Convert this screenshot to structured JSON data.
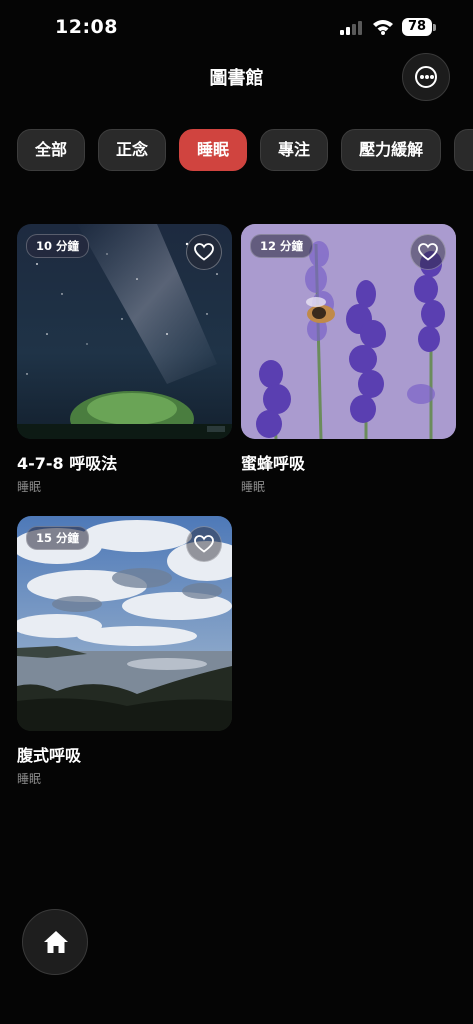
{
  "status": {
    "time": "12:08",
    "battery": "78"
  },
  "header": {
    "title": "圖書館",
    "more_icon": "more-horizontal-icon"
  },
  "filters": [
    {
      "label": "全部",
      "active": false
    },
    {
      "label": "正念",
      "active": false
    },
    {
      "label": "睡眠",
      "active": true
    },
    {
      "label": "專注",
      "active": false
    },
    {
      "label": "壓力緩解",
      "active": false
    },
    {
      "label": "",
      "active": false
    }
  ],
  "cards": [
    {
      "duration": "10 分鐘",
      "title": "4-7-8 呼吸法",
      "category": "睡眠",
      "image": "night-sky-milky-way"
    },
    {
      "duration": "12 分鐘",
      "title": "蜜蜂呼吸",
      "category": "睡眠",
      "image": "lavender-with-bee"
    },
    {
      "duration": "15 分鐘",
      "title": "腹式呼吸",
      "category": "睡眠",
      "image": "cloudy-sky-over-sea"
    }
  ],
  "nav": {
    "home_icon": "home-icon"
  },
  "colors": {
    "accent": "#d0443f",
    "background": "#050505",
    "chip": "#2a2a2a"
  }
}
